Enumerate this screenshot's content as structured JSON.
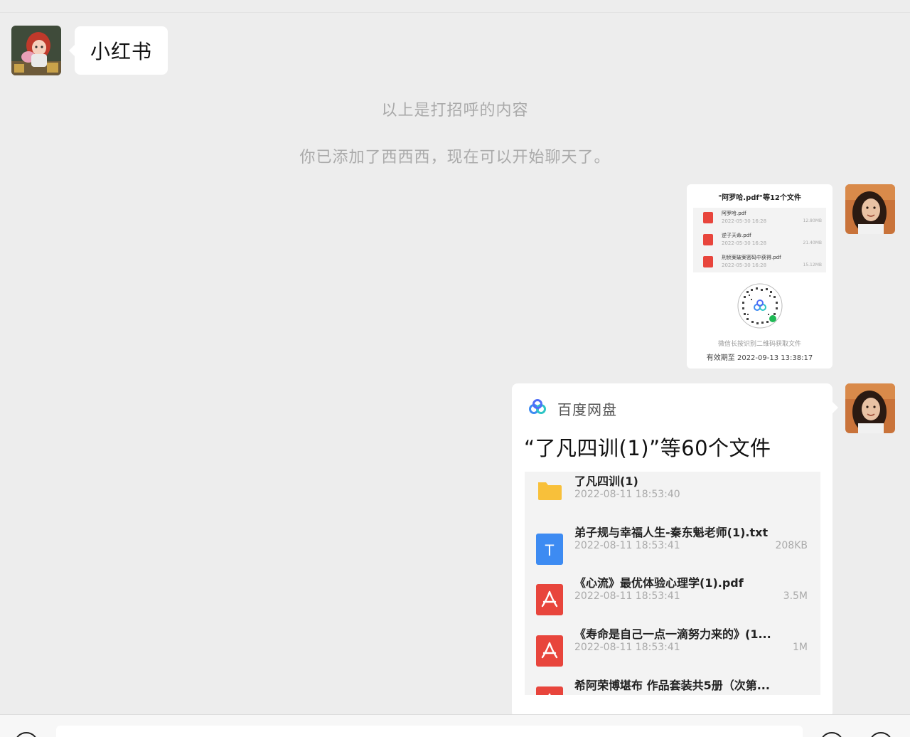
{
  "chat": {
    "incoming_message": "小红书",
    "system_messages": [
      "以上是打招呼的内容",
      "你已添加了西西西，现在可以开始聊天了。"
    ]
  },
  "share_card_small": {
    "title": "\"阿罗哈.pdf\"等12个文件",
    "files": [
      {
        "name": "阿罗哈.pdf",
        "date": "2022-05-30 16:28",
        "size": "12.80MB"
      },
      {
        "name": "逆子天命.pdf",
        "date": "2022-05-30 16:28",
        "size": "21.40MB"
      },
      {
        "name": "刑侦案破案密码中获得.pdf",
        "date": "2022-05-30 16:28",
        "size": "15.12MB"
      }
    ],
    "hint": "微信长按识别二维码获取文件",
    "expire": "有效期至 2022-09-13 13:38:17"
  },
  "share_card": {
    "brand": "百度网盘",
    "title": "“了凡四训(1)”等60个文件",
    "files": [
      {
        "name": "了凡四训(1)",
        "date": "2022-08-11 18:53:40",
        "size": "",
        "type": "folder"
      },
      {
        "name": "弟子规与幸福人生-秦东魁老师(1).txt",
        "date": "2022-08-11 18:53:41",
        "size": "208KB",
        "type": "txt"
      },
      {
        "name": "《心流》最优体验心理学(1).pdf",
        "date": "2022-08-11 18:53:41",
        "size": "3.5M",
        "type": "pdf"
      },
      {
        "name": "《寿命是自己一点一滴努力来的》(1...",
        "date": "2022-08-11 18:53:41",
        "size": "1M",
        "type": "pdf"
      },
      {
        "name": "希阿荣博堪布 作品套装共5册（次第...",
        "date": "",
        "size": "",
        "type": "pdf"
      }
    ]
  },
  "colors": {
    "background": "#ededed",
    "pdf": "#e8453c",
    "txt": "#3d8bf2",
    "folder": "#f8c03a"
  },
  "icons": [
    "contact-avatar",
    "my-avatar",
    "baidu-netdisk-logo",
    "pdf-icon",
    "txt-icon",
    "folder-icon",
    "qr-code"
  ]
}
